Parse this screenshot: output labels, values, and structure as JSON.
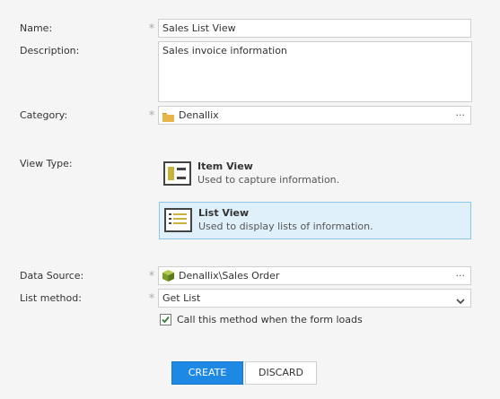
{
  "form": {
    "name": {
      "label": "Name:",
      "value": "Sales List View"
    },
    "description": {
      "label": "Description:",
      "value": "Sales invoice information"
    },
    "category": {
      "label": "Category:",
      "value": "Denallix",
      "browse": "···"
    },
    "view_type": {
      "label": "View Type:",
      "options": [
        {
          "title": "Item View",
          "desc": "Used to capture information.",
          "selected": false
        },
        {
          "title": "List View",
          "desc": "Used to display lists of information.",
          "selected": true
        }
      ]
    },
    "data_source": {
      "label": "Data Source:",
      "value": "Denallix\\Sales Order",
      "browse": "···"
    },
    "list_method": {
      "label": "List method:",
      "value": "Get List"
    },
    "call_on_load": {
      "label": "Call this method when the form loads",
      "checked": true
    },
    "required_marker": "*"
  },
  "buttons": {
    "create": "CREATE",
    "discard": "DISCARD"
  },
  "colors": {
    "primary": "#1e88e5",
    "selected_bg": "#dff0fa",
    "folder": "#e8b54a",
    "check": "#2e7d32"
  }
}
